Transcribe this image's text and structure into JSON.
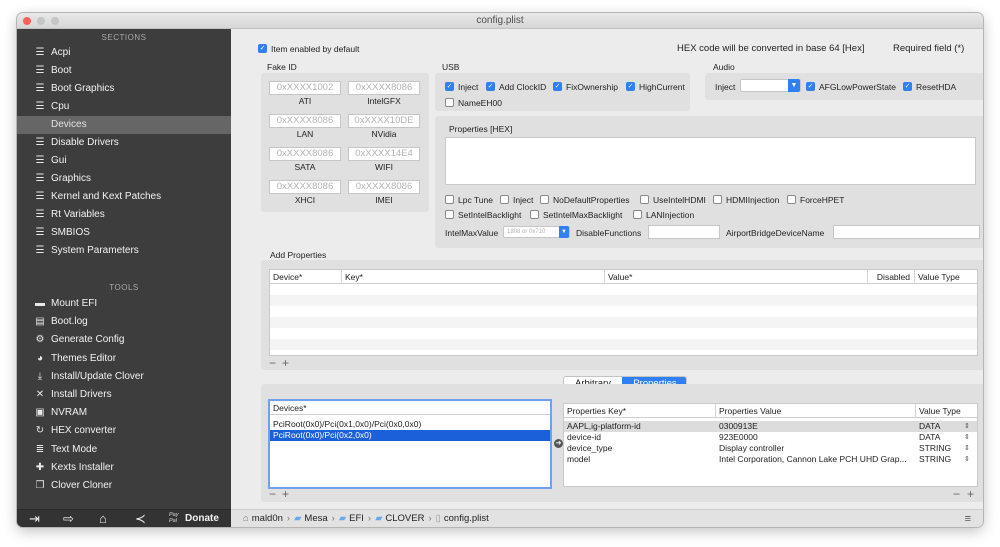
{
  "window": {
    "title": "config.plist"
  },
  "sidebar": {
    "sections_header": "SECTIONS",
    "tools_header": "TOOLS",
    "sections": [
      {
        "label": "Acpi",
        "icon": "list-icon"
      },
      {
        "label": "Boot",
        "icon": "list-icon"
      },
      {
        "label": "Boot Graphics",
        "icon": "list-icon"
      },
      {
        "label": "Cpu",
        "icon": "list-icon"
      },
      {
        "label": "Devices",
        "icon": "list-icon"
      },
      {
        "label": "Disable Drivers",
        "icon": "list-icon"
      },
      {
        "label": "Gui",
        "icon": "list-icon"
      },
      {
        "label": "Graphics",
        "icon": "list-icon"
      },
      {
        "label": "Kernel and Kext Patches",
        "icon": "list-icon"
      },
      {
        "label": "Rt Variables",
        "icon": "list-icon"
      },
      {
        "label": "SMBIOS",
        "icon": "list-icon"
      },
      {
        "label": "System Parameters",
        "icon": "list-icon"
      }
    ],
    "selected_section": "Devices",
    "tools": [
      {
        "label": "Mount EFI",
        "icon": "drive-icon"
      },
      {
        "label": "Boot.log",
        "icon": "log-icon"
      },
      {
        "label": "Generate Config",
        "icon": "gears-icon"
      },
      {
        "label": "Themes Editor",
        "icon": "palette-icon"
      },
      {
        "label": "Install/Update Clover",
        "icon": "download-icon"
      },
      {
        "label": "Install Drivers",
        "icon": "tools-icon"
      },
      {
        "label": "NVRAM",
        "icon": "chip-icon"
      },
      {
        "label": "HEX converter",
        "icon": "refresh-icon"
      },
      {
        "label": "Text Mode",
        "icon": "text-icon"
      },
      {
        "label": "Kexts Installer",
        "icon": "puzzle-icon"
      },
      {
        "label": "Clover Cloner",
        "icon": "clone-icon"
      }
    ],
    "footer": {
      "paypal_text": "Pay Pal",
      "donate_label": "Donate"
    }
  },
  "header": {
    "item_enabled_label": "Item enabled by default",
    "hex_note": "HEX code will be converted in base 64 [Hex]",
    "required_note": "Required field (*)"
  },
  "fake_id": {
    "title": "Fake ID",
    "fields": [
      {
        "placeholder": "0xXXXX1002",
        "label": "ATI"
      },
      {
        "placeholder": "0xXXXX8086",
        "label": "IntelGFX"
      },
      {
        "placeholder": "0xXXXX8086",
        "label": "LAN"
      },
      {
        "placeholder": "0xXXXX10DE",
        "label": "NVidia"
      },
      {
        "placeholder": "0xXXXX8086",
        "label": "SATA"
      },
      {
        "placeholder": "0xXXXX14E4",
        "label": "WIFI"
      },
      {
        "placeholder": "0xXXXX8086",
        "label": "XHCI"
      },
      {
        "placeholder": "0xXXXX8086",
        "label": "IMEI"
      }
    ]
  },
  "usb": {
    "title": "USB",
    "options": [
      {
        "label": "Inject",
        "checked": true
      },
      {
        "label": "Add ClockID",
        "checked": true
      },
      {
        "label": "FixOwnership",
        "checked": true
      },
      {
        "label": "HighCurrent",
        "checked": true
      },
      {
        "label": "NameEH00",
        "checked": false
      }
    ]
  },
  "audio": {
    "title": "Audio",
    "inject_label": "Inject",
    "options": [
      {
        "label": "AFGLowPowerState",
        "checked": true
      },
      {
        "label": "ResetHDA",
        "checked": true
      }
    ]
  },
  "properties_hex": {
    "title": "Properties [HEX]",
    "row1": [
      {
        "label": "Lpc Tune",
        "checked": false
      },
      {
        "label": "Inject",
        "checked": false
      },
      {
        "label": "NoDefaultProperties",
        "checked": false
      },
      {
        "label": "UseIntelHDMI",
        "checked": false
      },
      {
        "label": "HDMIInjection",
        "checked": false
      },
      {
        "label": "ForceHPET",
        "checked": false
      }
    ],
    "row2": [
      {
        "label": "SetIntelBacklight",
        "checked": false
      },
      {
        "label": "SetIntelMaxBacklight",
        "checked": false
      },
      {
        "label": "LANInjection",
        "checked": false
      }
    ],
    "intel_max_value_label": "IntelMaxValue",
    "intel_max_value_placeholder": "1808 or 0x710",
    "disable_functions_label": "DisableFunctions",
    "airport_label": "AirportBridgeDeviceName"
  },
  "add_properties": {
    "title": "Add Properties",
    "columns": [
      "Device*",
      "Key*",
      "Value*",
      "Disabled",
      "Value Type"
    ]
  },
  "tabs": {
    "items": [
      "Arbitrary",
      "Properties"
    ],
    "active": "Properties"
  },
  "devices": {
    "header": "Devices*",
    "items": [
      "PciRoot(0x0)/Pci(0x1,0x0)/Pci(0x0,0x0)",
      "PciRoot(0x0)/Pci(0x2,0x0)"
    ],
    "selected_index": 1
  },
  "properties_table": {
    "columns": [
      "Properties Key*",
      "Properties Value",
      "Value Type"
    ],
    "rows": [
      {
        "key": "AAPL,ig-platform-id",
        "value": "0300913E",
        "type": "DATA"
      },
      {
        "key": "device-id",
        "value": "923E0000",
        "type": "DATA"
      },
      {
        "key": "device_type",
        "value": "Display controller",
        "type": "STRING"
      },
      {
        "key": "model",
        "value": "Intel Corporation, Cannon Lake PCH UHD Grap...",
        "type": "STRING"
      }
    ]
  },
  "pathbar": {
    "items": [
      "mald0n",
      "Mesa",
      "EFI",
      "CLOVER",
      "config.plist"
    ]
  },
  "colors": {
    "accent": "#2f7ff5",
    "sidebar_bg": "#3d3d3d",
    "selection": "#1b5fd9"
  }
}
